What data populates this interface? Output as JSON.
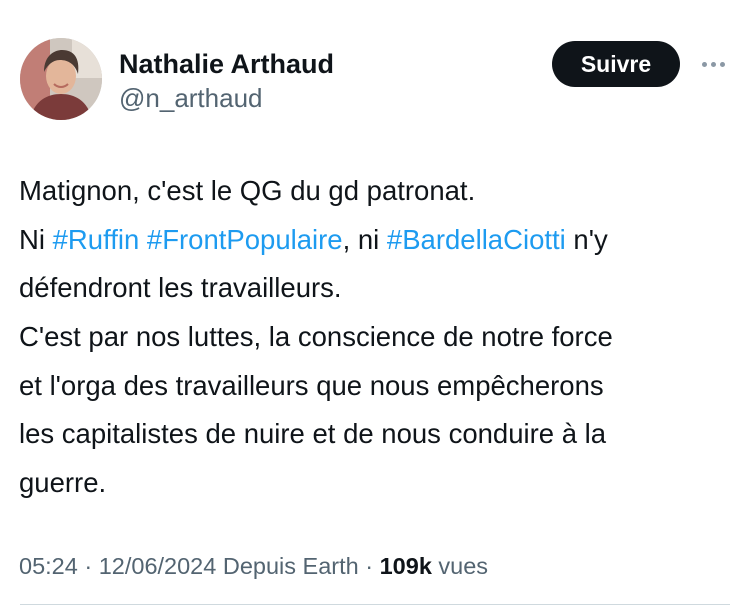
{
  "author": {
    "display_name": "Nathalie Arthaud",
    "handle": "@n_arthaud"
  },
  "actions": {
    "follow_label": "Suivre",
    "more_icon": "ellipsis-icon"
  },
  "tweet": {
    "lines": [
      [
        {
          "t": "Matignon, c'est le QG du gd patronat."
        }
      ],
      [
        {
          "t": "Ni "
        },
        {
          "t": "#Ruffin",
          "tag": true
        },
        {
          "t": " "
        },
        {
          "t": "#FrontPopulaire",
          "tag": true
        },
        {
          "t": ", ni "
        },
        {
          "t": "#BardellaCiotti",
          "tag": true
        },
        {
          "t": " n'y"
        }
      ],
      [
        {
          "t": "défendront les travailleurs."
        }
      ],
      [
        {
          "t": "C'est par nos luttes, la conscience de notre force"
        }
      ],
      [
        {
          "t": "et l'orga des travailleurs que nous empêcherons"
        }
      ],
      [
        {
          "t": "les capitalistes de nuire et de nous conduire à la"
        }
      ],
      [
        {
          "t": "guerre."
        }
      ]
    ]
  },
  "meta": {
    "time": "05:24",
    "separator": " · ",
    "date": "12/06/2024",
    "source": " Depuis Earth",
    "views_count": "109k",
    "views_label": " vues"
  },
  "colors": {
    "hashtag": "#1d9bf0",
    "text": "#0f1419",
    "secondary": "#536471",
    "follow_bg": "#0f1419"
  }
}
